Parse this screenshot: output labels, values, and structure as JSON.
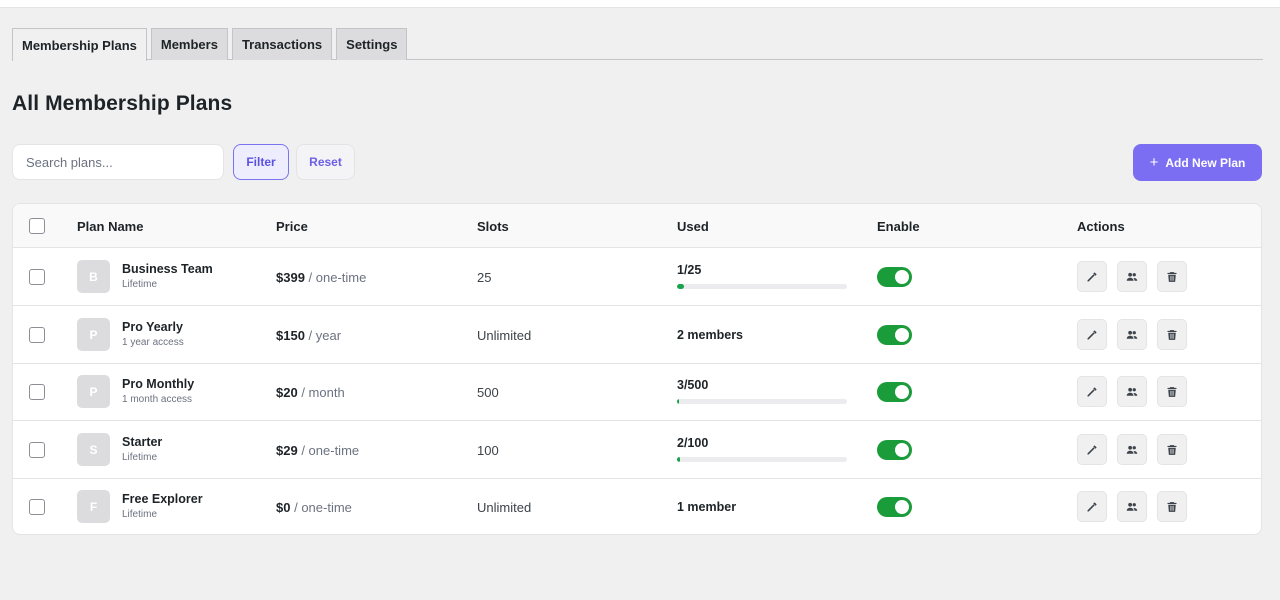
{
  "tabs": [
    {
      "label": "Membership Plans",
      "active": true
    },
    {
      "label": "Members",
      "active": false
    },
    {
      "label": "Transactions",
      "active": false
    },
    {
      "label": "Settings",
      "active": false
    }
  ],
  "page_title": "All Membership Plans",
  "toolbar": {
    "search_placeholder": "Search plans...",
    "filter_label": "Filter",
    "reset_label": "Reset",
    "add_label": "Add New Plan",
    "add_icon": "plus-icon"
  },
  "table": {
    "headers": {
      "plan_name": "Plan Name",
      "price": "Price",
      "slots": "Slots",
      "used": "Used",
      "enable": "Enable",
      "actions": "Actions"
    },
    "rows": [
      {
        "initial": "B",
        "name": "Business Team",
        "sub": "Lifetime",
        "amount": "$399",
        "period": "/ one-time",
        "slots": "25",
        "used": "1/25",
        "progress": 0.04,
        "enabled": true
      },
      {
        "initial": "P",
        "name": "Pro Yearly",
        "sub": "1 year access",
        "amount": "$150",
        "period": "/ year",
        "slots": "Unlimited",
        "used": "2 members",
        "progress": null,
        "enabled": true
      },
      {
        "initial": "P",
        "name": "Pro Monthly",
        "sub": "1 month access",
        "amount": "$20",
        "period": "/ month",
        "slots": "500",
        "used": "3/500",
        "progress": 0.006,
        "enabled": true
      },
      {
        "initial": "S",
        "name": "Starter",
        "sub": "Lifetime",
        "amount": "$29",
        "period": "/ one-time",
        "slots": "100",
        "used": "2/100",
        "progress": 0.02,
        "enabled": true
      },
      {
        "initial": "F",
        "name": "Free Explorer",
        "sub": "Lifetime",
        "amount": "$0",
        "period": "/ one-time",
        "slots": "Unlimited",
        "used": "1 member",
        "progress": null,
        "enabled": true
      }
    ],
    "action_icons": [
      "edit-icon",
      "members-icon",
      "delete-icon"
    ]
  },
  "colors": {
    "accent": "#7b6ef3",
    "toggle_on": "#1a9c3a",
    "progress": "#16a34a"
  }
}
